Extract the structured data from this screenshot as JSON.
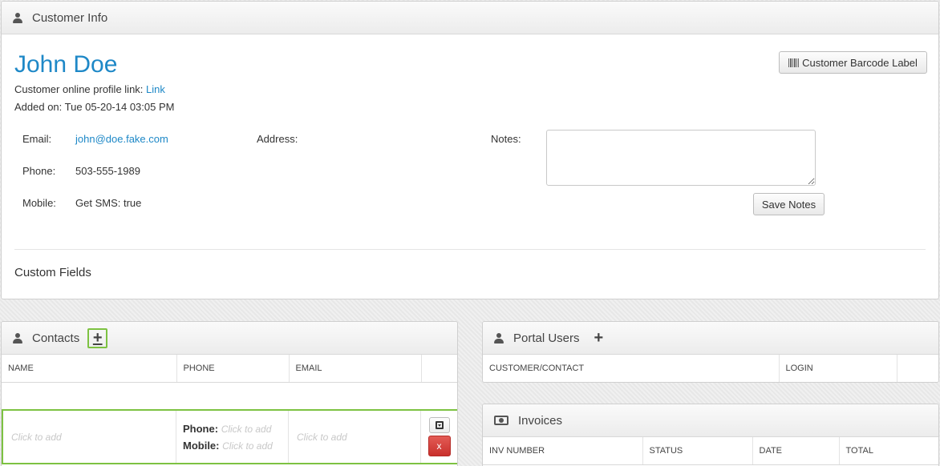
{
  "customer_info": {
    "title": "Customer Info",
    "name": "John Doe",
    "profile_label": "Customer online profile link:",
    "profile_link": "Link",
    "added_on": "Added on: Tue 05-20-14 03:05 PM",
    "barcode_button": "Customer Barcode Label",
    "email_label": "Email:",
    "email_value": "john@doe.fake.com",
    "phone_label": "Phone:",
    "phone_value": "503-555-1989",
    "mobile_label": "Mobile:",
    "mobile_value": "Get SMS: true",
    "address_label": "Address:",
    "notes_label": "Notes:",
    "notes_value": "",
    "save_notes_button": "Save Notes",
    "custom_fields_label": "Custom Fields"
  },
  "contacts": {
    "title": "Contacts",
    "add_icon": "plus-icon",
    "columns": [
      "NAME",
      "PHONE",
      "EMAIL",
      ""
    ],
    "new_row": {
      "name_placeholder": "Click to add",
      "phone_label": "Phone:",
      "phone_placeholder": "Click to add",
      "mobile_label": "Mobile:",
      "mobile_placeholder": "Click to add",
      "email_placeholder": "Click to add",
      "delete_label": "x"
    }
  },
  "portal_users": {
    "title": "Portal Users",
    "columns": [
      "CUSTOMER/CONTACT",
      "LOGIN",
      ""
    ]
  },
  "invoices": {
    "title": "Invoices",
    "columns": [
      "INV NUMBER",
      "STATUS",
      "DATE",
      "TOTAL"
    ]
  },
  "colors": {
    "accent": "#1e88c7",
    "highlight": "#7dc242",
    "danger": "#d9534f"
  }
}
